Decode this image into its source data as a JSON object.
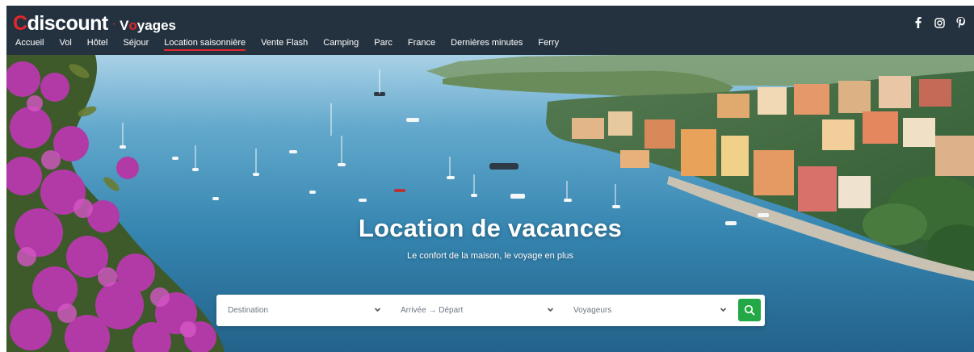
{
  "header": {
    "logo": {
      "c": "C",
      "brand": "discount",
      "dot": "·",
      "v": "V",
      "o": "o",
      "rest": "yages"
    },
    "nav": [
      {
        "label": "Accueil"
      },
      {
        "label": "Vol"
      },
      {
        "label": "Hôtel"
      },
      {
        "label": "Séjour"
      },
      {
        "label": "Location saisonnière",
        "active": true
      },
      {
        "label": "Vente Flash"
      },
      {
        "label": "Camping"
      },
      {
        "label": "Parc"
      },
      {
        "label": "France"
      },
      {
        "label": "Dernières minutes"
      },
      {
        "label": "Ferry"
      }
    ],
    "social": [
      "facebook-icon",
      "instagram-icon",
      "pinterest-icon"
    ]
  },
  "hero": {
    "title": "Location de vacances",
    "subtitle": "Le confort de la maison, le voyage en plus"
  },
  "search": {
    "destination_placeholder": "Destination",
    "dates_placeholder": "Arrivée → Départ",
    "travelers_placeholder": "Voyageurs",
    "button_icon": "search-icon"
  },
  "colors": {
    "header_bg": "#243240",
    "brand_red": "#e3262c",
    "search_green": "#22a845"
  }
}
